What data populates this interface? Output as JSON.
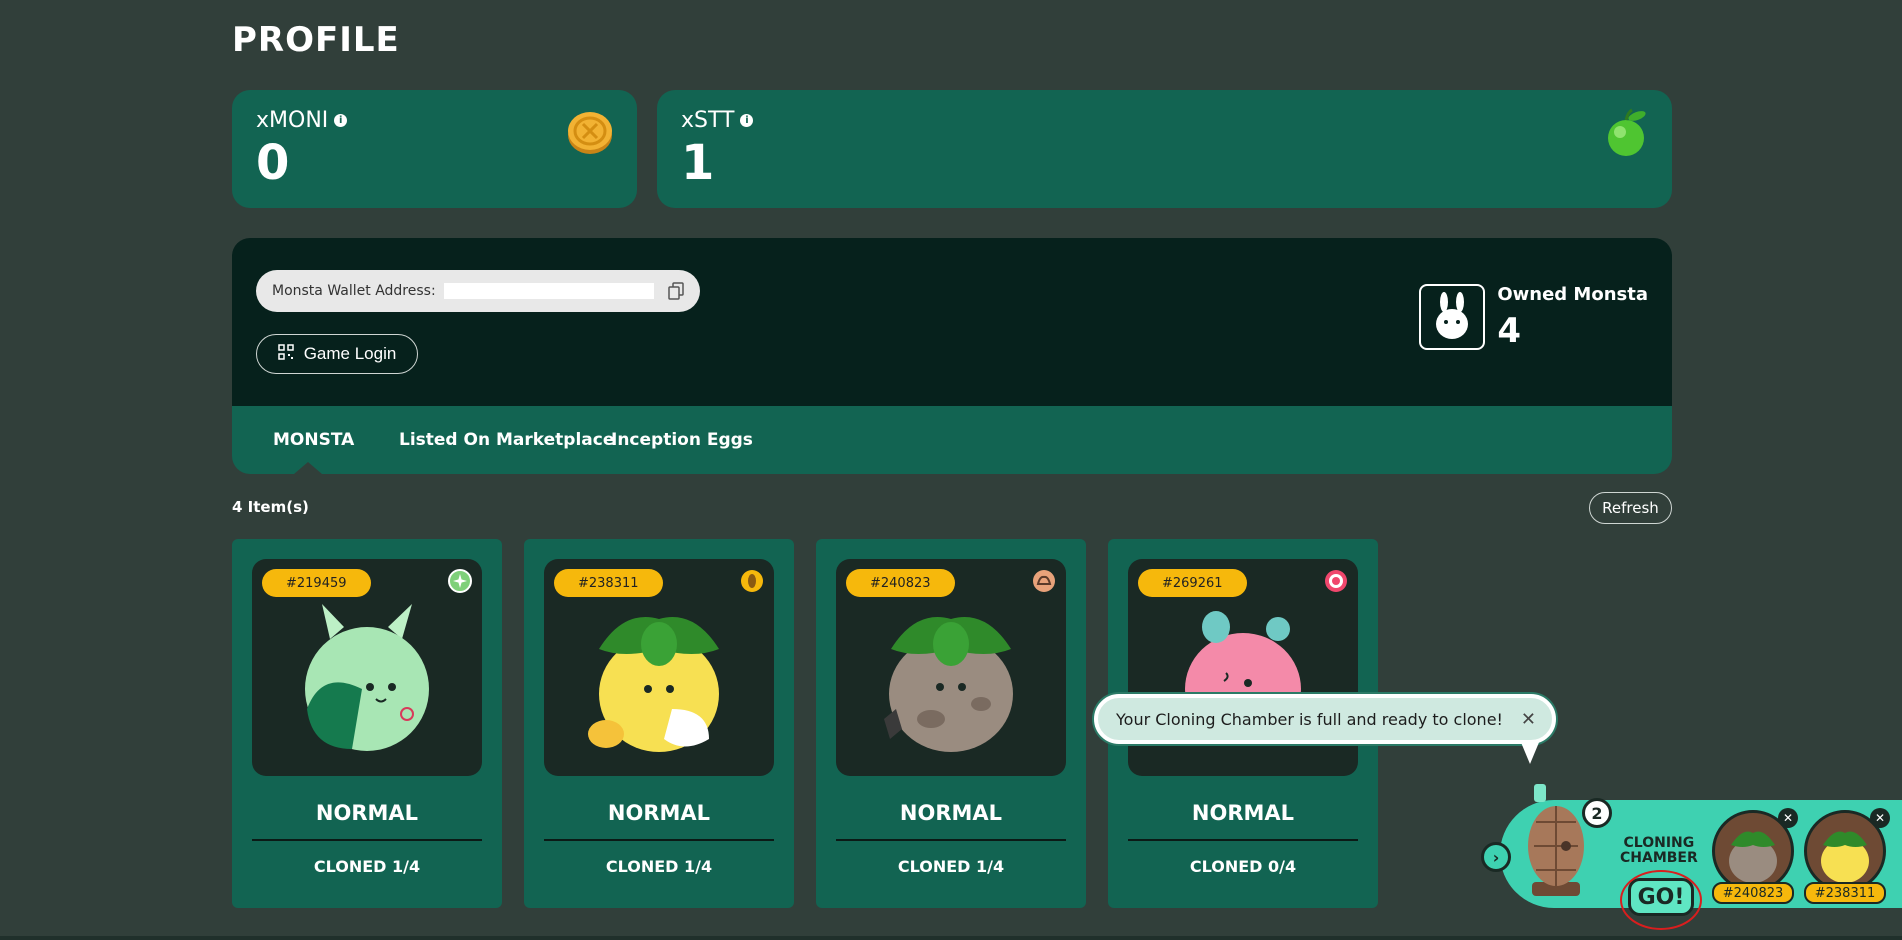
{
  "page": {
    "title": "PROFILE"
  },
  "stats": [
    {
      "label": "xMONI",
      "value": "0",
      "icon": "coin-icon"
    },
    {
      "label": "xSTT",
      "value": "1",
      "icon": "green-apple-icon"
    }
  ],
  "wallet": {
    "address_label": "Monsta Wallet Address:",
    "game_login_label": "Game Login",
    "owned_label": "Owned Monsta",
    "owned_count": "4"
  },
  "tabs": [
    {
      "label": "MONSTA",
      "active": true
    },
    {
      "label": "Listed On Marketplace",
      "active": false
    },
    {
      "label": "Inception Eggs",
      "active": false
    }
  ],
  "items": {
    "count_label": "4 Item(s)",
    "refresh_label": "Refresh",
    "cards": [
      {
        "id": "#219459",
        "rarity": "NORMAL",
        "cloned": "CLONED 1/4",
        "element": "leaf-element-icon",
        "color": "#a8e6b4"
      },
      {
        "id": "#238311",
        "rarity": "NORMAL",
        "cloned": "CLONED 1/4",
        "element": "seed-element-icon",
        "color": "#f7e052"
      },
      {
        "id": "#240823",
        "rarity": "NORMAL",
        "cloned": "CLONED 1/4",
        "element": "earth-element-icon",
        "color": "#9a8c80"
      },
      {
        "id": "#269261",
        "rarity": "NORMAL",
        "cloned": "CLONED 0/4",
        "element": "target-element-icon",
        "color": "#f48aa9"
      }
    ]
  },
  "cloning": {
    "tooltip": "Your Cloning Chamber is full and ready to clone!",
    "count": "2",
    "label_line1": "CLONING",
    "label_line2": "CHAMBER",
    "go_label": "GO!",
    "slots": [
      "#240823",
      "#238311"
    ]
  }
}
